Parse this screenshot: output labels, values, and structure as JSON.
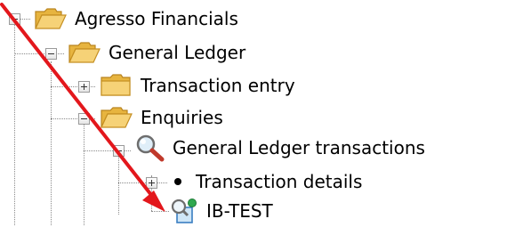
{
  "tree": {
    "root": {
      "label": "Agresso Financials",
      "icon": "open-folder-icon",
      "expanded": true
    },
    "general_ledger": {
      "label": "General Ledger",
      "icon": "open-folder-icon",
      "expanded": true
    },
    "transaction_entry": {
      "label": "Transaction entry",
      "icon": "closed-folder-icon",
      "expanded": false
    },
    "enquiries": {
      "label": "Enquiries",
      "icon": "open-folder-icon",
      "expanded": true
    },
    "gl_transactions": {
      "label": "General Ledger transactions",
      "icon": "magnifier-icon",
      "expanded": true
    },
    "transaction_details": {
      "label": "Transaction details",
      "icon": "bullet-icon",
      "expanded": false
    },
    "ib_test": {
      "label": "IB-TEST",
      "icon": "saved-query-icon"
    }
  },
  "annotation": {
    "type": "arrow",
    "color": "#e3171c"
  }
}
